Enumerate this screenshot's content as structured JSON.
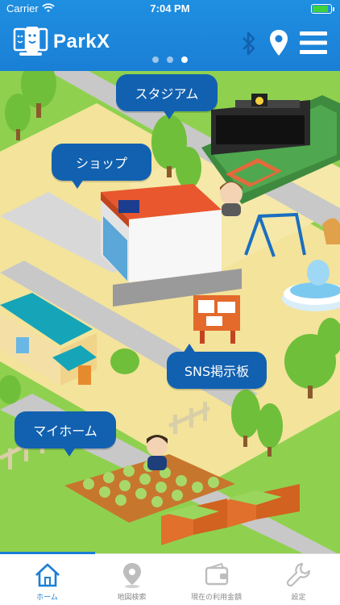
{
  "status_bar": {
    "carrier": "Carrier",
    "time": "7:04 PM"
  },
  "header": {
    "app_name": "ParkX",
    "page_count": 3,
    "active_page": 3
  },
  "map": {
    "bubbles": {
      "stadium": "スタジアム",
      "shop": "ショップ",
      "sns": "SNS掲示板",
      "home": "マイホーム"
    }
  },
  "tabbar": {
    "tabs": [
      {
        "label": "ホーム",
        "icon": "home-icon",
        "active": true
      },
      {
        "label": "地図検索",
        "icon": "map-pin-icon",
        "active": false
      },
      {
        "label": "現在の利用金額",
        "icon": "wallet-icon",
        "active": false
      },
      {
        "label": "設定",
        "icon": "wrench-icon",
        "active": false
      }
    ]
  },
  "colors": {
    "header": "#1a7fd6",
    "bubble": "#1261b0",
    "grass": "#8fd14f",
    "tab_active": "#1a7fd6",
    "tab_inactive": "#8a8a8a"
  }
}
